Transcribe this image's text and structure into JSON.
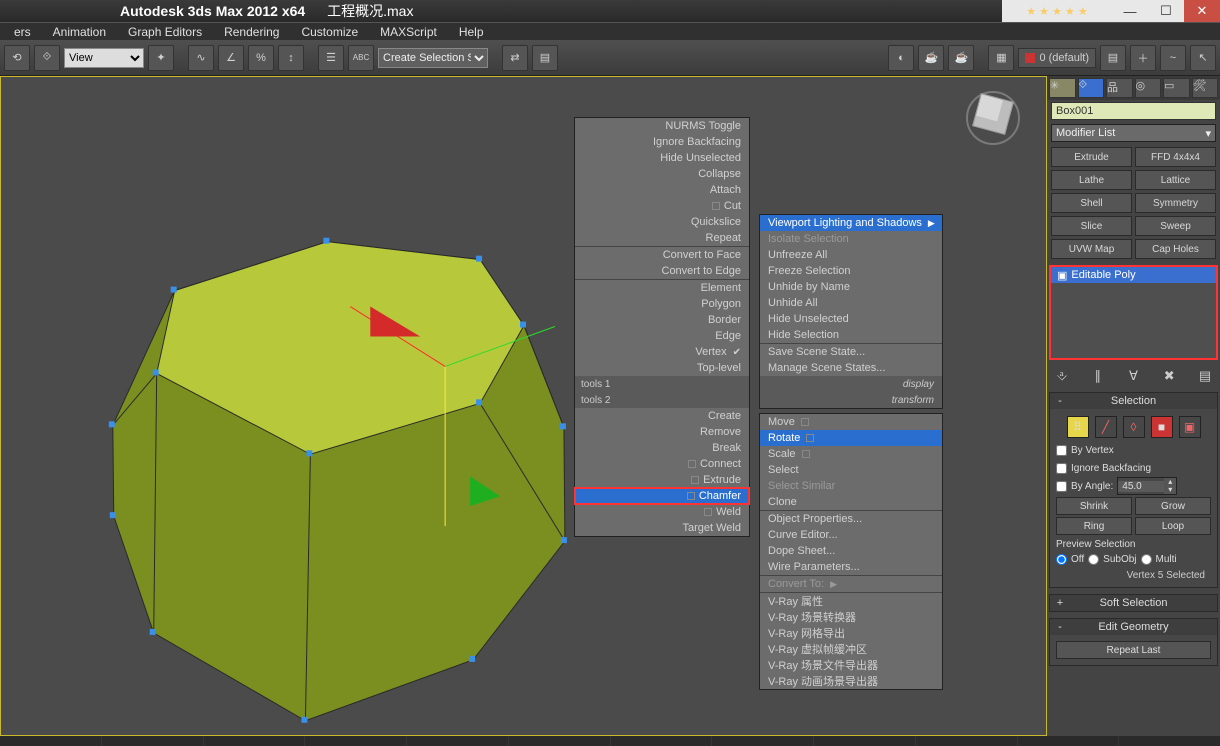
{
  "app": {
    "name": "Autodesk 3ds Max  2012 x64",
    "file": "工程概况.max"
  },
  "menu": [
    "ers",
    "Animation",
    "Graph Editors",
    "Rendering",
    "Customize",
    "MAXScript",
    "Help"
  ],
  "toolbar": {
    "view_label": "View",
    "selset_label": "Create Selection Se",
    "layer_default": "0 (default)"
  },
  "ctx1": {
    "group1": [
      "NURMS Toggle",
      "Ignore Backfacing",
      "Hide Unselected",
      "Collapse",
      "Attach",
      "Cut",
      "Quickslice",
      "Repeat"
    ],
    "group2": [
      "Convert to Face",
      "Convert to Edge"
    ],
    "group3": [
      "Element",
      "Polygon",
      "Border",
      "Edge",
      "Vertex",
      "Top-level"
    ],
    "vertex_checked": true,
    "head_tools1": "tools 1",
    "head_tools2": "tools 2",
    "head_display": "display",
    "head_transform": "transform",
    "group4": [
      "Create",
      "Remove",
      "Break",
      "Connect",
      "Extrude",
      "Chamfer",
      "Weld",
      "Target Weld"
    ],
    "chamfer_highlight": true
  },
  "ctx2a": {
    "items": [
      {
        "t": "Viewport Lighting and Shadows",
        "sub": true,
        "hl": true
      },
      {
        "t": "Isolate Selection",
        "dim": true
      },
      {
        "t": "Unfreeze All"
      },
      {
        "t": "Freeze Selection"
      },
      {
        "t": "Unhide by Name"
      },
      {
        "t": "Unhide All"
      },
      {
        "t": "Hide Unselected"
      },
      {
        "t": "Hide Selection"
      },
      {
        "t": "Save Scene State..."
      },
      {
        "t": "Manage Scene States..."
      }
    ]
  },
  "ctx2b": {
    "items": [
      {
        "t": "Move",
        "box": true
      },
      {
        "t": "Rotate",
        "box": true,
        "hl": true
      },
      {
        "t": "Scale",
        "box": true
      },
      {
        "t": "Select"
      },
      {
        "t": "Select Similar",
        "dim": true
      },
      {
        "t": "Clone"
      },
      {
        "t": "Object Properties..."
      },
      {
        "t": "Curve Editor..."
      },
      {
        "t": "Dope Sheet..."
      },
      {
        "t": "Wire Parameters..."
      },
      {
        "t": "Convert To:",
        "dim": true
      },
      {
        "t": "V-Ray 属性"
      },
      {
        "t": "V-Ray 场景转换器"
      },
      {
        "t": "V-Ray 网格导出"
      },
      {
        "t": "V-Ray 虚拟帧缓冲区"
      },
      {
        "t": "V-Ray 场景文件导出器"
      },
      {
        "t": "V-Ray 动画场景导出器"
      }
    ]
  },
  "panel": {
    "object_name": "Box001",
    "modifier_list": "Modifier List",
    "mods": [
      "Extrude",
      "FFD 4x4x4",
      "Lathe",
      "Lattice",
      "Shell",
      "Symmetry",
      "Slice",
      "Sweep",
      "UVW Map",
      "Cap Holes"
    ],
    "stack_item": "Editable Poly",
    "rollups": {
      "selection": "Selection",
      "by_vertex": "By Vertex",
      "ignore_backfacing": "Ignore Backfacing",
      "by_angle": "By Angle:",
      "angle_val": "45.0",
      "shrink": "Shrink",
      "grow": "Grow",
      "ring": "Ring",
      "loop": "Loop",
      "preview_sel": "Preview Selection",
      "off": "Off",
      "subobj": "SubObj",
      "multi": "Multi",
      "status": "Vertex 5 Selected",
      "soft_selection": "Soft Selection",
      "edit_geometry": "Edit Geometry",
      "repeat_last": "Repeat Last"
    }
  }
}
